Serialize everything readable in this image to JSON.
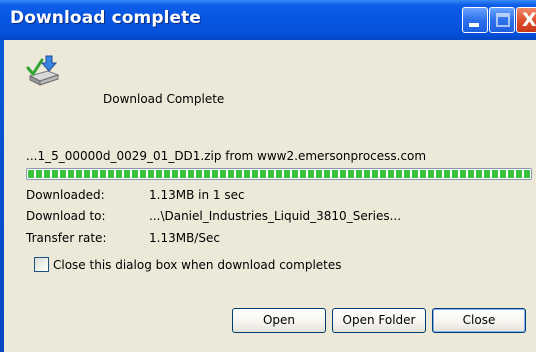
{
  "window": {
    "title": "Download complete"
  },
  "title_controls": {
    "close_glyph": "X"
  },
  "dialog": {
    "icon": "file-download-check-icon",
    "status_text": "Download Complete",
    "source_line": "...1_5_00000d_0029_01_DD1.zip from www2.emersonprocess.com",
    "progress_percent": 100,
    "details": [
      {
        "label": "Downloaded:",
        "value": "1.13MB in 1 sec"
      },
      {
        "label": "Download to:",
        "value": "...\\Daniel_Industries_Liquid_3810_Series..."
      },
      {
        "label": "Transfer rate:",
        "value": "1.13MB/Sec"
      }
    ],
    "close_on_complete": {
      "label": "Close this dialog box when download completes",
      "checked": false
    }
  },
  "buttons": {
    "open": "Open",
    "open_folder": "Open Folder",
    "close": "Close"
  },
  "colors": {
    "title_bar": "#0655e2",
    "client_background": "#ece9d8",
    "progress_fill": "#39c239"
  }
}
